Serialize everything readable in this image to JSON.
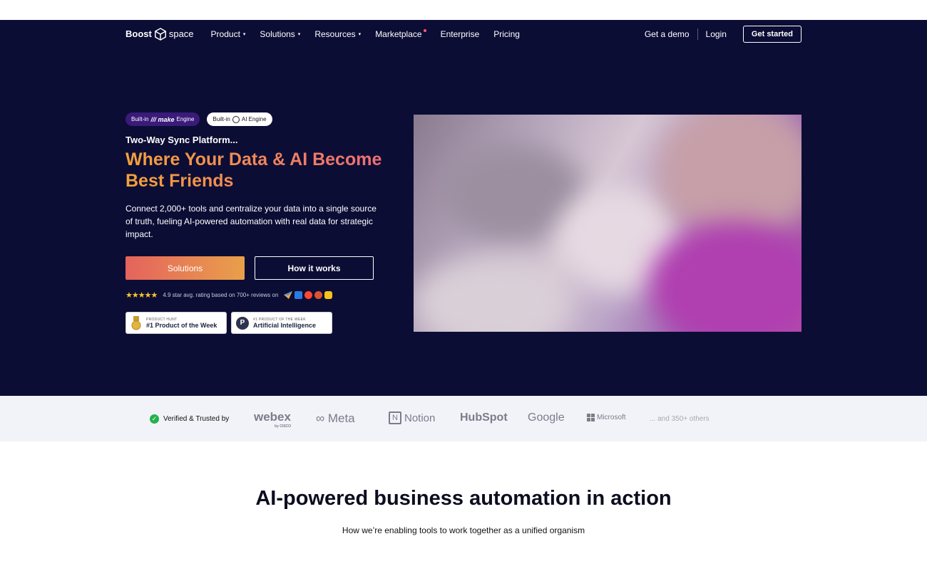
{
  "nav": {
    "logo_left": "Boost",
    "logo_right": "space",
    "links": [
      {
        "label": "Product",
        "caret": "▾"
      },
      {
        "label": "Solutions",
        "caret": "▾"
      },
      {
        "label": "Resources",
        "caret": "▾"
      },
      {
        "label": "Marketplace",
        "caret": ""
      },
      {
        "label": "Enterprise",
        "caret": ""
      },
      {
        "label": "Pricing",
        "caret": ""
      }
    ],
    "demo": "Get a demo",
    "login": "Login",
    "get_started": "Get started"
  },
  "hero": {
    "badge_make_prefix": "Built-in",
    "badge_make_brand": "/// make",
    "badge_make_suffix": "Engine",
    "badge_ai_prefix": "Built-in",
    "badge_ai_suffix": "AI Engine",
    "tagline": "Two-Way Sync Platform...",
    "headline": "Where Your Data & AI Become Best Friends",
    "subtext": "Connect 2,000+ tools and centralize your data into a single source of truth, fueling AI-powered automation with real data for strategic impact.",
    "cta_primary": "Solutions",
    "cta_secondary": "How it works",
    "stars": "★★★★★",
    "rating_text": "4.9 star avg. rating based on 700+ reviews on",
    "award1_small": "PRODUCT HUNT",
    "award1_big": "#1 Product of the Week",
    "award2_small": "#1 PRODUCT OF THE WEEK",
    "award2_big": "Artificial Intelligence",
    "award2_letter": "P"
  },
  "trust": {
    "label": "Verified & Trusted by",
    "brands": {
      "webex": "webex",
      "webex_sub": "by CISCO",
      "meta": "∞ Meta",
      "notion": "Notion",
      "notion_letter": "N",
      "hubspot": "HubSpot",
      "google": "Google",
      "microsoft": "Microsoft"
    },
    "others": "... and 350+ others"
  },
  "section": {
    "title": "AI-powered business automation in action",
    "subtitle": "How we’re enabling tools to work together as a unified organism"
  },
  "colors": {
    "hero_bg": "#0c0d35",
    "accent_orange": "#f4a23a",
    "accent_pink": "#ee6b78",
    "trust_bg": "#f2f3f8"
  }
}
